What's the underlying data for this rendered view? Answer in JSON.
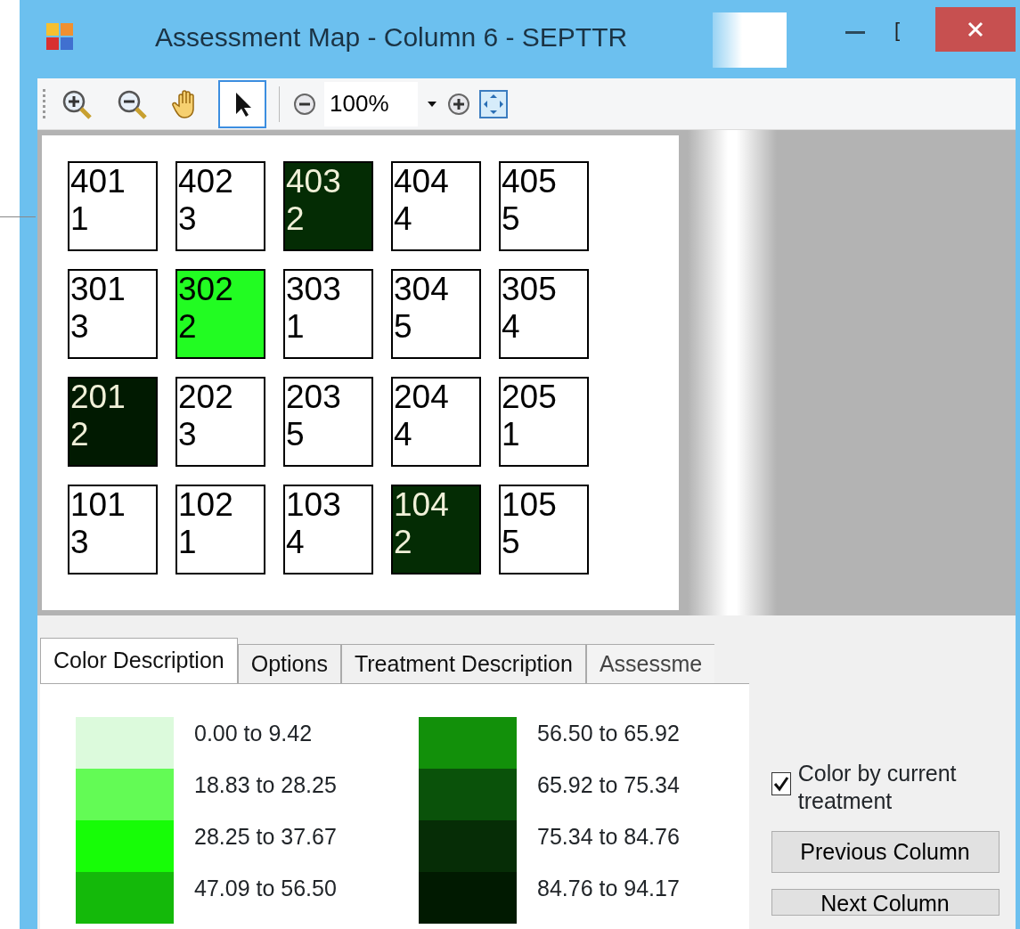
{
  "window": {
    "title": "Assessment Map - Column 6 - SEPTTR",
    "maximize_glyph": "["
  },
  "toolbar": {
    "tools": [
      {
        "kind": "zoom-in",
        "selected": false
      },
      {
        "kind": "zoom-out",
        "selected": false
      },
      {
        "kind": "pan",
        "selected": false
      },
      {
        "kind": "pointer",
        "selected": true
      }
    ],
    "zoom_value": "100%"
  },
  "plots": [
    [
      {
        "plot": "401",
        "treatment": "1",
        "color": "#ffffff"
      },
      {
        "plot": "402",
        "treatment": "3",
        "color": "#ffffff"
      },
      {
        "plot": "403",
        "treatment": "2",
        "color": "#042c04"
      },
      {
        "plot": "404",
        "treatment": "4",
        "color": "#ffffff"
      },
      {
        "plot": "405",
        "treatment": "5",
        "color": "#ffffff"
      }
    ],
    [
      {
        "plot": "301",
        "treatment": "3",
        "color": "#ffffff"
      },
      {
        "plot": "302",
        "treatment": "2",
        "color": "#22fc22"
      },
      {
        "plot": "303",
        "treatment": "1",
        "color": "#ffffff"
      },
      {
        "plot": "304",
        "treatment": "5",
        "color": "#ffffff"
      },
      {
        "plot": "305",
        "treatment": "4",
        "color": "#ffffff"
      }
    ],
    [
      {
        "plot": "201",
        "treatment": "2",
        "color": "#011a01"
      },
      {
        "plot": "202",
        "treatment": "3",
        "color": "#ffffff"
      },
      {
        "plot": "203",
        "treatment": "5",
        "color": "#ffffff"
      },
      {
        "plot": "204",
        "treatment": "4",
        "color": "#ffffff"
      },
      {
        "plot": "205",
        "treatment": "1",
        "color": "#ffffff"
      }
    ],
    [
      {
        "plot": "101",
        "treatment": "3",
        "color": "#ffffff"
      },
      {
        "plot": "102",
        "treatment": "1",
        "color": "#ffffff"
      },
      {
        "plot": "103",
        "treatment": "4",
        "color": "#ffffff"
      },
      {
        "plot": "104",
        "treatment": "2",
        "color": "#042c04"
      },
      {
        "plot": "105",
        "treatment": "5",
        "color": "#ffffff"
      }
    ]
  ],
  "tabs": [
    {
      "label": "Color Description",
      "selected": true
    },
    {
      "label": "Options",
      "selected": false
    },
    {
      "label": "Treatment Description",
      "selected": false
    },
    {
      "label": "Assessme",
      "selected": false
    }
  ],
  "legend": [
    {
      "range": "0.00 to 9.42",
      "color": "#dcfadc"
    },
    {
      "range": "18.83 to 28.25",
      "color": "#63fb55"
    },
    {
      "range": "28.25 to 37.67",
      "color": "#17fd07"
    },
    {
      "range": "47.09 to 56.50",
      "color": "#14b90a"
    },
    {
      "range": "56.50 to 65.92",
      "color": "#12900a"
    },
    {
      "range": "65.92 to 75.34",
      "color": "#0a520a"
    },
    {
      "range": "75.34 to 84.76",
      "color": "#062d06"
    },
    {
      "range": "84.76 to 94.17",
      "color": "#011a01"
    }
  ],
  "color_by_treatment": {
    "label": "Color by current treatment",
    "checked": true
  },
  "buttons": [
    "Previous Column",
    "Next Column"
  ]
}
